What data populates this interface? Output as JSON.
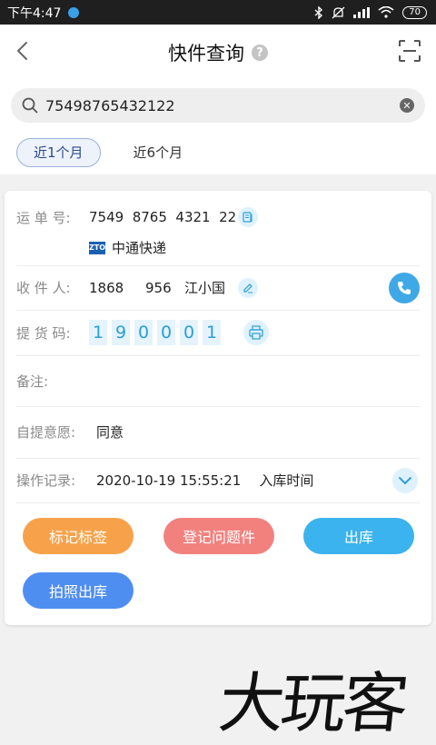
{
  "status_bar": {
    "time": "下午4:47",
    "battery": "70"
  },
  "header": {
    "title": "快件查询",
    "help_icon": "?"
  },
  "search": {
    "value": "75498765432122",
    "placeholder": ""
  },
  "tabs": [
    {
      "label": "近1个月",
      "active": true
    },
    {
      "label": "近6个月",
      "active": false
    }
  ],
  "detail": {
    "waybill_label": "运 单 号:",
    "waybill_number": "7549  8765  4321  22",
    "courier_logo_text": "ZTO",
    "courier_name": "中通快递",
    "recipient_label": "收 件 人:",
    "recipient_value": "1868     956   江小国",
    "pickup_label": "提 货 码:",
    "pickup_code": [
      "1",
      "9",
      "0",
      "0",
      "0",
      "1"
    ],
    "remark_label": "备注:",
    "remark_value": "",
    "self_pickup_label": "自提意愿:",
    "self_pickup_value": "同意",
    "op_label": "操作记录:",
    "op_time": "2020-10-19 15:55:21",
    "op_desc": "入库时间"
  },
  "actions": {
    "mark_label": "标记标签",
    "problem_label": "登记问题件",
    "checkout_label": "出库",
    "photo_checkout_label": "拍照出库"
  },
  "colors": {
    "mark": "#f7a24a",
    "problem": "#f2817e",
    "checkout": "#3bb3ee",
    "photo_checkout": "#4f8ef1",
    "accent_blue": "#3fa8e6"
  },
  "watermark": "大玩客"
}
